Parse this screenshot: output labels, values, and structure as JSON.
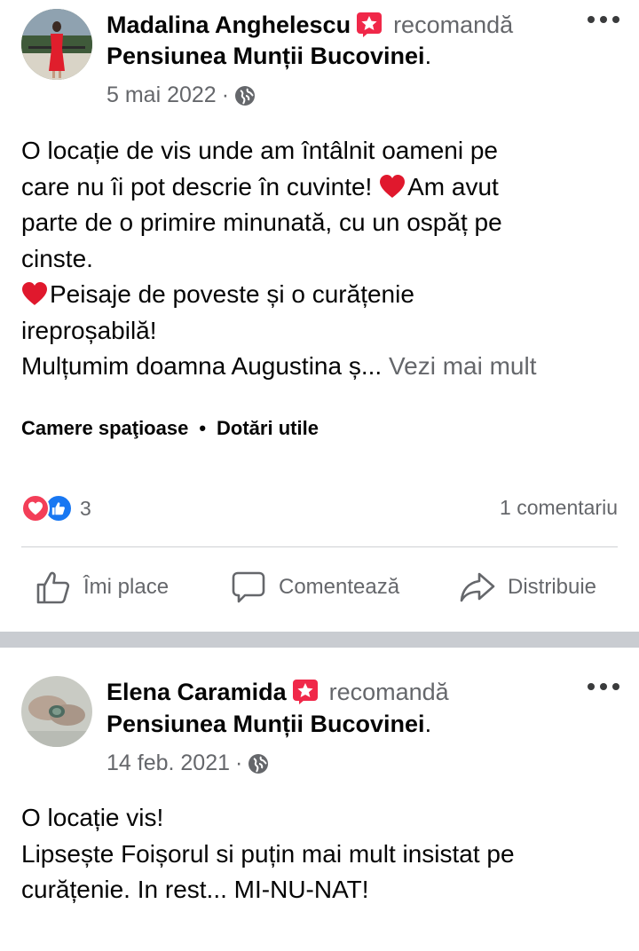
{
  "posts": [
    {
      "author": "Madalina Anghelescu",
      "recommends": "recomandă",
      "page": "Pensiunea Munții Bucovinei",
      "date": "5 mai 2022",
      "meta_sep": "·",
      "body": [
        "O locație de vis unde am întâlnit oameni pe",
        "care nu îi pot descrie în cuvinte! ",
        "Am avut",
        "parte de o primire minunată, cu un ospăț pe",
        "cinste.",
        "Peisaje de poveste și o curățenie",
        "ireproșabilă!",
        "Mulțumim doamna Augustina ș... "
      ],
      "see_more": "Vezi mai mult",
      "tags": [
        "Camere spaţioase",
        "Dotări utile"
      ],
      "tag_sep": "•",
      "reaction_count": "3",
      "comments": "1 comentariu",
      "actions": {
        "like": "Îmi place",
        "comment": "Comentează",
        "share": "Distribuie"
      }
    },
    {
      "author": "Elena Caramida",
      "recommends": "recomandă",
      "page": "Pensiunea Munții Bucovinei",
      "date": "14 feb. 2021",
      "meta_sep": "·",
      "body": [
        "O locație vis!",
        "Lipsește Foișorul si puțin mai mult insistat pe",
        "curățenie. In rest... MI-NU-NAT!"
      ]
    }
  ],
  "icons": {
    "recommend_badge": "star-badge-icon",
    "privacy": "globe-icon",
    "menu": "more-options-icon",
    "heart": "red-heart-icon",
    "react_love": "love-reaction-icon",
    "react_like": "like-reaction-icon",
    "action_like": "thumbs-up-icon",
    "action_comment": "comment-bubble-icon",
    "action_share": "share-arrow-icon"
  },
  "colors": {
    "text": "#050505",
    "secondary": "#65676b",
    "badge": "#f02849",
    "love": "#f33e58",
    "like": "#1877f2",
    "separator": "#c9ccd1"
  }
}
